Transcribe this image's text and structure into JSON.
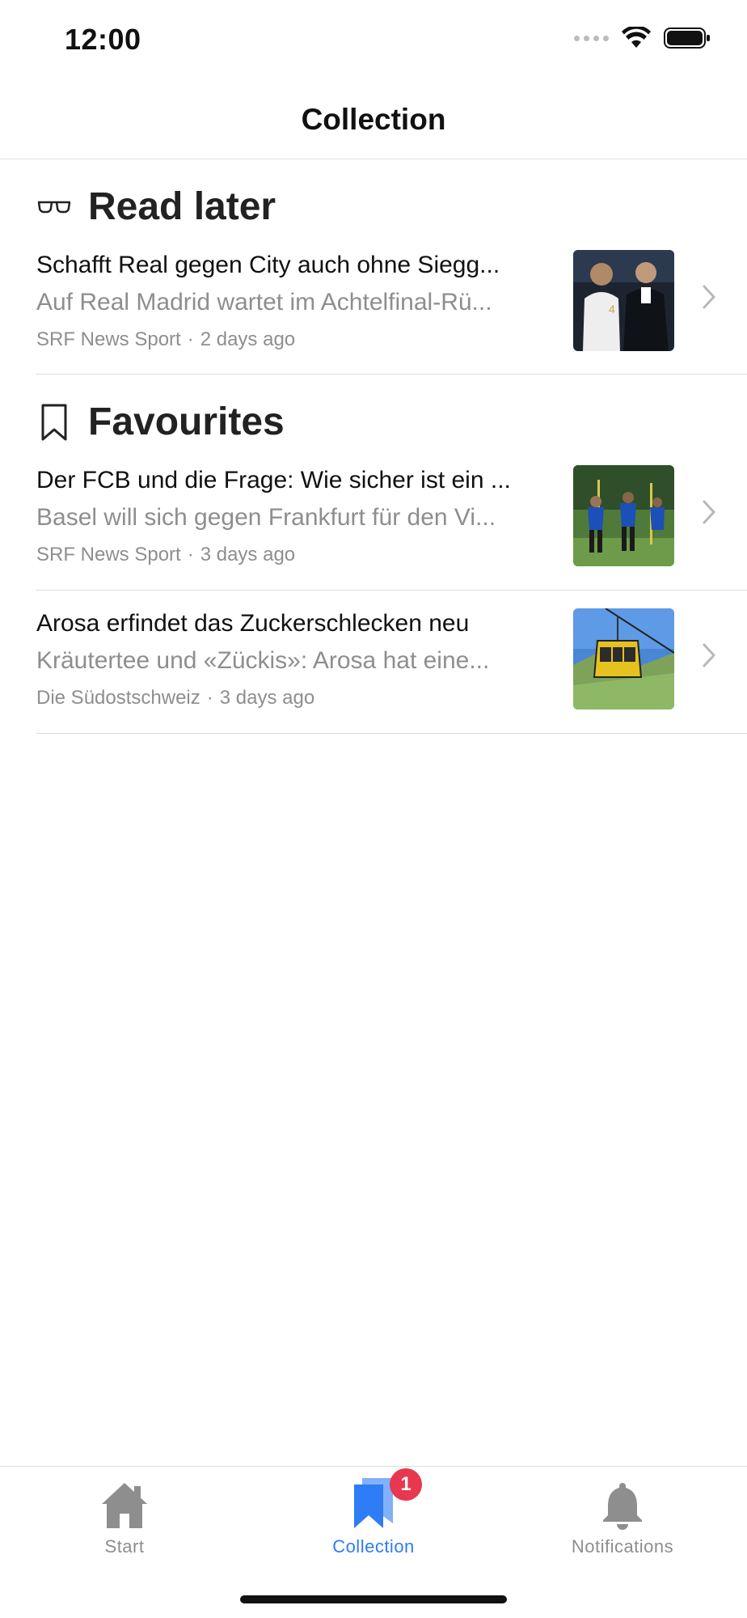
{
  "status_bar": {
    "time": "12:00"
  },
  "nav": {
    "title": "Collection"
  },
  "sections": {
    "read_later": {
      "title": "Read later",
      "icon": "glasses-icon",
      "articles": [
        {
          "title": "Schafft Real gegen City auch ohne Siegg...",
          "teaser": "Auf Real Madrid wartet im Achtelfinal-Rü...",
          "source": "SRF News Sport",
          "separator": "·",
          "time": "2 days ago"
        }
      ]
    },
    "favourites": {
      "title": "Favourites",
      "icon": "bookmark-icon",
      "articles": [
        {
          "title": "Der FCB und die Frage: Wie sicher ist ein ...",
          "teaser": "Basel will sich gegen Frankfurt für den Vi...",
          "source": "SRF News Sport",
          "separator": "·",
          "time": "3 days ago"
        },
        {
          "title": "Arosa erfindet das Zuckerschlecken neu",
          "teaser": "Kräutertee und «Zückis»: Arosa hat eine...",
          "source": "Die Südostschweiz",
          "separator": "·",
          "time": "3 days ago"
        }
      ]
    }
  },
  "tab_bar": {
    "tabs": [
      {
        "label": "Start",
        "icon": "home-icon",
        "active": false
      },
      {
        "label": "Collection",
        "icon": "bookmark-icon",
        "active": true,
        "badge": "1"
      },
      {
        "label": "Notifications",
        "icon": "bell-icon",
        "active": false
      }
    ]
  },
  "colors": {
    "accent": "#2e7cf6",
    "badge": "#e8384f",
    "secondary_text": "#8e8e8e",
    "divider": "#dcdcdc"
  }
}
